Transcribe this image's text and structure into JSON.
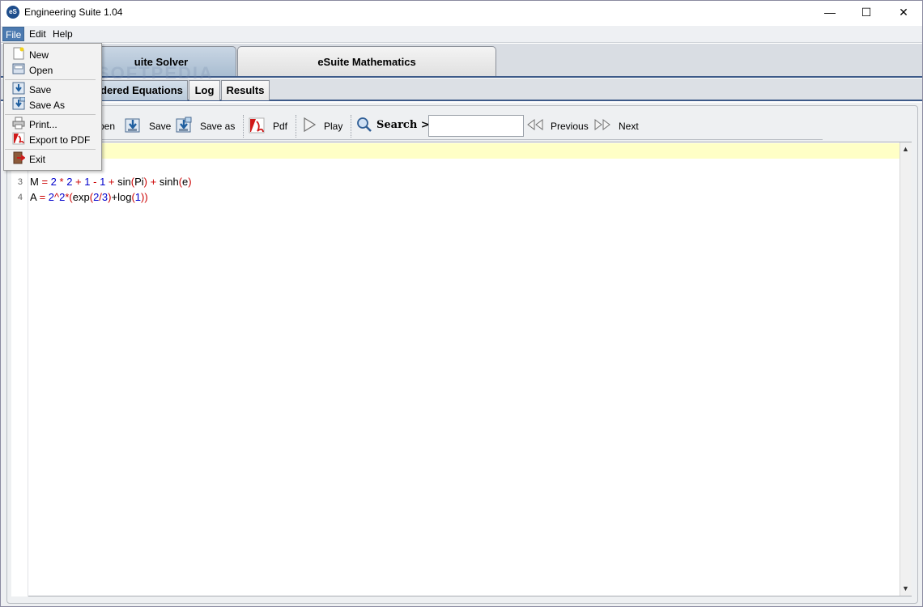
{
  "window": {
    "title": "Engineering Suite 1.04",
    "icon_text": "eS",
    "controls": {
      "minimize": "—",
      "maximize": "☐",
      "close": "✕"
    }
  },
  "menubar": {
    "items": [
      "File",
      "Edit",
      "Help"
    ]
  },
  "file_menu": {
    "items": [
      "New",
      "Open",
      "Save",
      "Save As",
      "Print...",
      "Export to PDF",
      "Exit"
    ]
  },
  "main_tabs": [
    {
      "label": "uite Solver",
      "active": true
    },
    {
      "label": "eSuite Mathematics",
      "active": false
    }
  ],
  "sub_tabs": [
    {
      "label": "dered Equations",
      "active": true
    },
    {
      "label": "Log",
      "active": false
    },
    {
      "label": "Results",
      "active": false
    }
  ],
  "toolbar": {
    "open_label": "pen",
    "save_label": "Save",
    "save_as_label": "Save as",
    "pdf_label": "Pdf",
    "play_label": "Play",
    "search_label": "Search >>",
    "search_value": "",
    "previous_label": "Previous",
    "next_label": "Next"
  },
  "editor": {
    "lines": [
      {
        "number": "3"
      },
      {
        "number": "4"
      }
    ]
  },
  "watermark": "SOFTPEDIA",
  "colors": {
    "accent_blue": "#3d5a89",
    "menu_highlight": "#4c7ab0",
    "current_line": "#ffffc6",
    "code_number": "#0000cc",
    "code_operator": "#cc0000"
  }
}
